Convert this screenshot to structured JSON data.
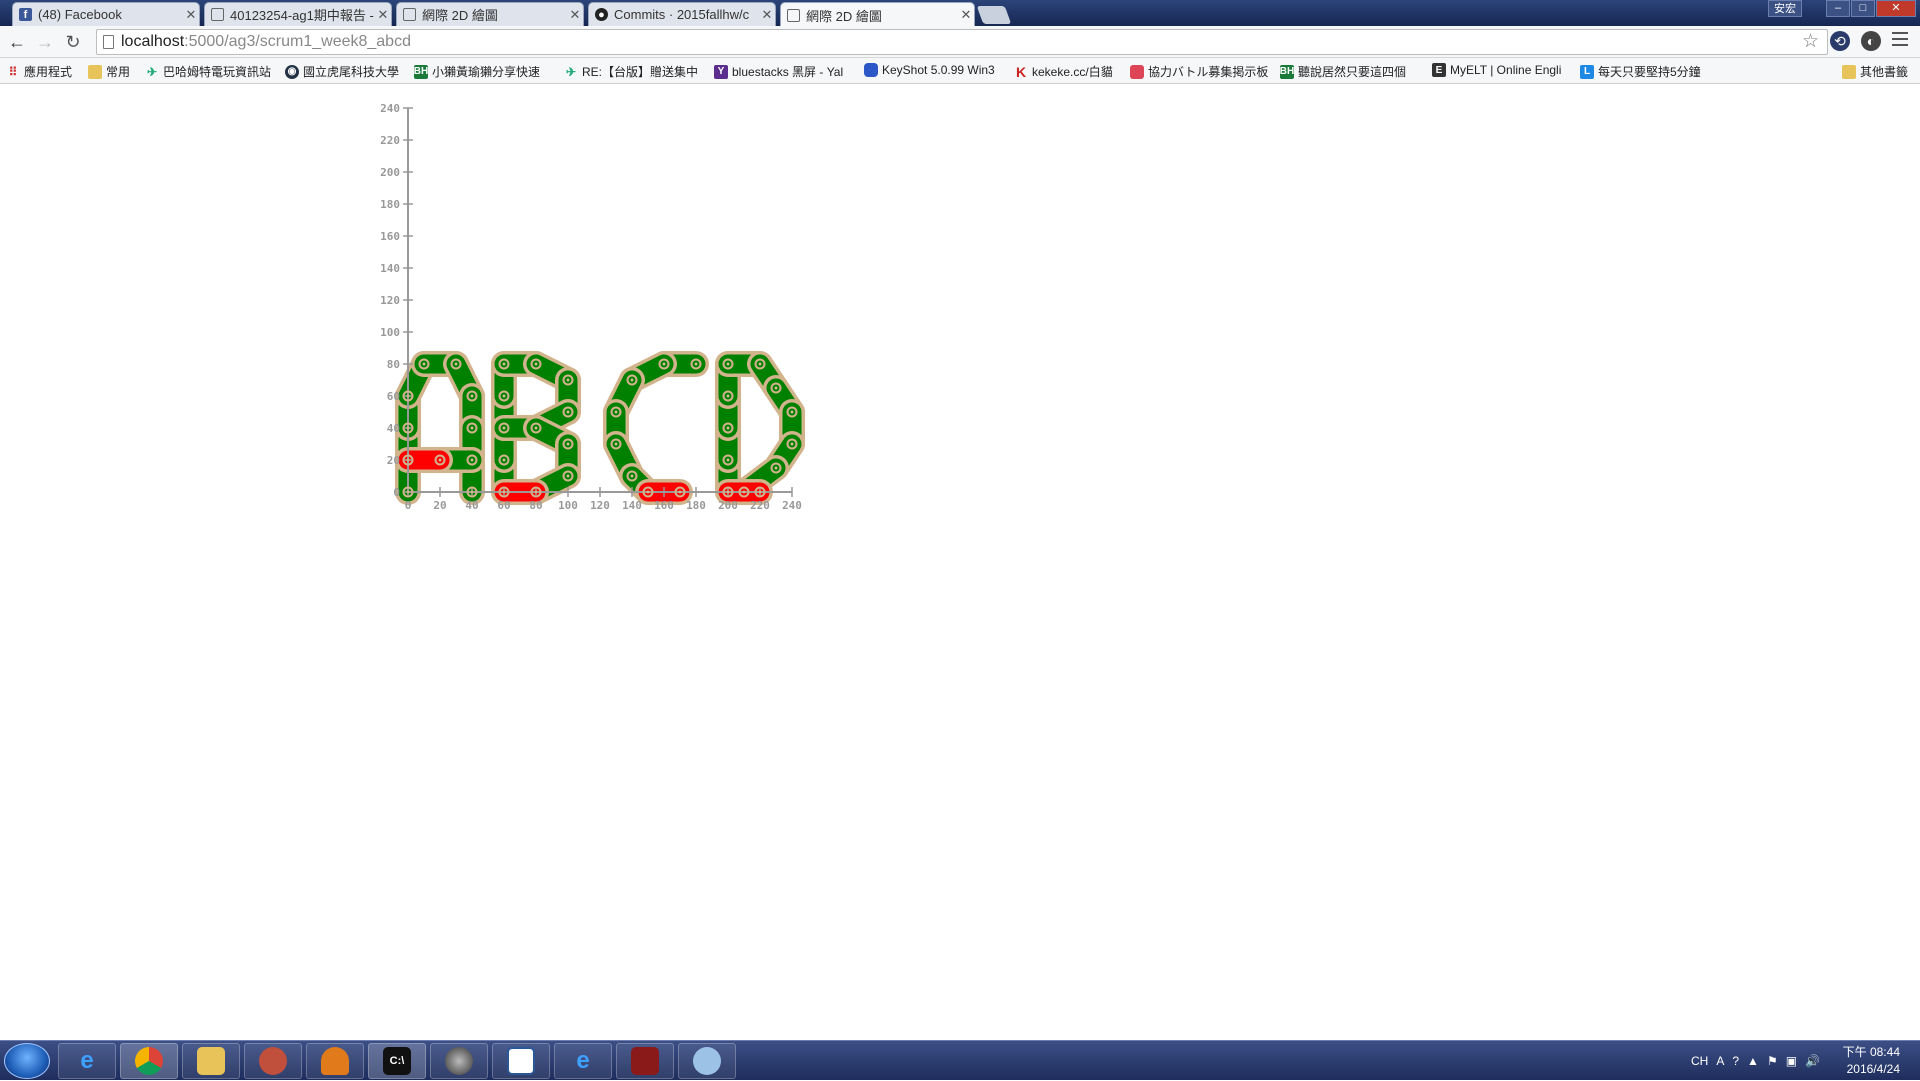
{
  "browser": {
    "tabs": [
      {
        "label": "(48) Facebook",
        "icon": "facebook-icon",
        "active": false
      },
      {
        "label": "40123254-ag1期中報告 -",
        "icon": "page-icon",
        "active": false
      },
      {
        "label": "網際 2D 繪圖",
        "icon": "page-icon",
        "active": false
      },
      {
        "label": "Commits · 2015fallhw/c",
        "icon": "github-icon",
        "active": false
      },
      {
        "label": "網際 2D 繪圖",
        "icon": "page-icon",
        "active": true
      }
    ],
    "user_label": "安宏",
    "url_host": "localhost",
    "url_rest": ":5000/ag3/scrum1_week8_abcd",
    "bookmarks": [
      {
        "label": "應用程式",
        "icon": "apps-icon"
      },
      {
        "label": "常用",
        "icon": "folder-icon"
      },
      {
        "label": "巴哈姆特電玩資訊站",
        "icon": "bahamut-icon"
      },
      {
        "label": "國立虎尾科技大學",
        "icon": "nfu-icon"
      },
      {
        "label": "小獺黃瑜獺分享快速",
        "icon": "bh-icon"
      },
      {
        "label": "RE:【台版】贈送集中",
        "icon": "bahamut-icon"
      },
      {
        "label": "bluestacks 黑屏 - Yal",
        "icon": "yahoo-icon"
      },
      {
        "label": "KeyShot 5.0.99 Win3",
        "icon": "keyshot-icon"
      },
      {
        "label": "kekeke.cc/白貓",
        "icon": "kekeke-icon"
      },
      {
        "label": "協力バトル募集掲示板",
        "icon": "game-icon"
      },
      {
        "label": "聽說居然只要這四個",
        "icon": "bh-icon"
      },
      {
        "label": "MyELT | Online Engli",
        "icon": "myelt-icon"
      },
      {
        "label": "每天只要堅持5分鐘",
        "icon": "l-icon"
      }
    ],
    "other_bookmarks": "其他書籤"
  },
  "chart_data": {
    "type": "scatter",
    "title": "",
    "xlabel": "",
    "ylabel": "",
    "xlim": [
      0,
      240
    ],
    "ylim": [
      0,
      240
    ],
    "x_ticks": [
      "0",
      "20",
      "40",
      "60",
      "80",
      "100",
      "120",
      "140",
      "160",
      "180",
      "200",
      "220",
      "240"
    ],
    "y_ticks": [
      "0",
      "20",
      "40",
      "60",
      "80",
      "100",
      "120",
      "140",
      "160",
      "180",
      "200",
      "220",
      "240"
    ],
    "link_color": "#008000",
    "highlight_color": "#ff0000",
    "outline_color": "#d2b48c",
    "letters": [
      "A",
      "B",
      "C",
      "D"
    ],
    "green_links": [
      [
        [
          0,
          0
        ],
        [
          0,
          40
        ]
      ],
      [
        [
          0,
          40
        ],
        [
          0,
          60
        ]
      ],
      [
        [
          0,
          60
        ],
        [
          10,
          80
        ]
      ],
      [
        [
          10,
          80
        ],
        [
          30,
          80
        ]
      ],
      [
        [
          30,
          80
        ],
        [
          40,
          60
        ]
      ],
      [
        [
          40,
          60
        ],
        [
          40,
          40
        ]
      ],
      [
        [
          40,
          40
        ],
        [
          40,
          20
        ]
      ],
      [
        [
          40,
          20
        ],
        [
          40,
          0
        ]
      ],
      [
        [
          20,
          20
        ],
        [
          40,
          20
        ]
      ],
      [
        [
          60,
          0
        ],
        [
          60,
          20
        ]
      ],
      [
        [
          60,
          20
        ],
        [
          60,
          40
        ]
      ],
      [
        [
          60,
          40
        ],
        [
          60,
          60
        ]
      ],
      [
        [
          60,
          60
        ],
        [
          60,
          80
        ]
      ],
      [
        [
          60,
          80
        ],
        [
          80,
          80
        ]
      ],
      [
        [
          80,
          80
        ],
        [
          100,
          70
        ]
      ],
      [
        [
          100,
          70
        ],
        [
          100,
          50
        ]
      ],
      [
        [
          100,
          50
        ],
        [
          80,
          40
        ]
      ],
      [
        [
          80,
          40
        ],
        [
          60,
          40
        ]
      ],
      [
        [
          80,
          40
        ],
        [
          100,
          30
        ]
      ],
      [
        [
          100,
          30
        ],
        [
          100,
          10
        ]
      ],
      [
        [
          100,
          10
        ],
        [
          80,
          0
        ]
      ],
      [
        [
          180,
          80
        ],
        [
          160,
          80
        ]
      ],
      [
        [
          160,
          80
        ],
        [
          140,
          70
        ]
      ],
      [
        [
          140,
          70
        ],
        [
          130,
          50
        ]
      ],
      [
        [
          130,
          50
        ],
        [
          130,
          30
        ]
      ],
      [
        [
          130,
          30
        ],
        [
          140,
          10
        ]
      ],
      [
        [
          140,
          10
        ],
        [
          150,
          0
        ]
      ],
      [
        [
          200,
          0
        ],
        [
          200,
          20
        ]
      ],
      [
        [
          200,
          20
        ],
        [
          200,
          40
        ]
      ],
      [
        [
          200,
          40
        ],
        [
          200,
          60
        ]
      ],
      [
        [
          200,
          60
        ],
        [
          200,
          80
        ]
      ],
      [
        [
          200,
          80
        ],
        [
          220,
          80
        ]
      ],
      [
        [
          220,
          80
        ],
        [
          230,
          65
        ]
      ],
      [
        [
          230,
          65
        ],
        [
          240,
          50
        ]
      ],
      [
        [
          240,
          50
        ],
        [
          240,
          30
        ]
      ],
      [
        [
          240,
          30
        ],
        [
          230,
          15
        ]
      ],
      [
        [
          230,
          15
        ],
        [
          210,
          0
        ]
      ]
    ],
    "red_links": [
      [
        [
          0,
          20
        ],
        [
          20,
          20
        ]
      ],
      [
        [
          60,
          0
        ],
        [
          80,
          0
        ]
      ],
      [
        [
          150,
          0
        ],
        [
          170,
          0
        ]
      ],
      [
        [
          200,
          0
        ],
        [
          220,
          0
        ]
      ]
    ]
  },
  "taskbar": {
    "apps": [
      "ie-icon",
      "chrome-icon",
      "explorer-icon",
      "app-icon",
      "mushroom-icon",
      "cmd-icon",
      "sphere-icon",
      "window-icon",
      "ie-icon",
      "game-icon",
      "paint-icon"
    ],
    "tray_lang": "CH",
    "time": "下午 08:44",
    "date": "2016/4/24"
  }
}
